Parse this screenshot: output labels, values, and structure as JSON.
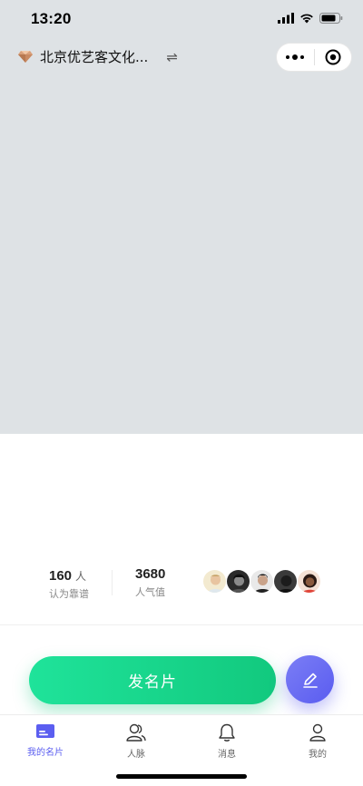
{
  "status_bar": {
    "time": "13:20",
    "icons": [
      "signal-icon",
      "wifi-icon",
      "battery-icon"
    ]
  },
  "header": {
    "title": "北京优艺客文化...",
    "switch_symbol": "⇌",
    "brand_icon": "diamond-icon",
    "capsule": {
      "more_icon": "more-dots-icon",
      "close_icon": "target-close-icon"
    }
  },
  "stats": {
    "reliable_count": "160",
    "reliable_unit": "人",
    "reliable_label": "认为靠谱",
    "popularity_count": "3680",
    "popularity_label": "人气值",
    "avatar_count": 5
  },
  "actions": {
    "send_card_label": "发名片",
    "edit_icon": "edit-pencil-icon"
  },
  "tabbar": {
    "items": [
      {
        "label": "我的名片",
        "icon": "card-icon",
        "active": true
      },
      {
        "label": "人脉",
        "icon": "contacts-icon",
        "active": false
      },
      {
        "label": "消息",
        "icon": "bell-icon",
        "active": false
      },
      {
        "label": "我的",
        "icon": "person-icon",
        "active": false
      }
    ]
  },
  "colors": {
    "accent_green": "#12c97e",
    "accent_purple": "#5b5ef0",
    "cover_bg": "#dee2e5"
  }
}
